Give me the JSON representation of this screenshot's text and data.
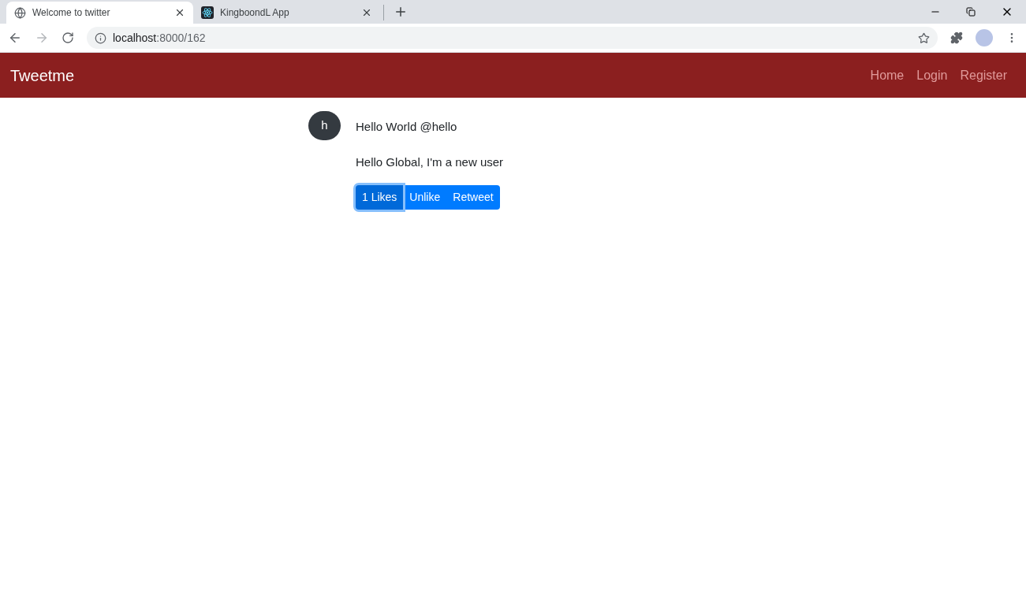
{
  "browser": {
    "tabs": [
      {
        "title": "Welcome to twitter",
        "selected": true,
        "kind": "globe"
      },
      {
        "title": "KingboondL App",
        "selected": false,
        "kind": "react"
      }
    ],
    "address": {
      "host": "localhost",
      "path": ":8000/162"
    },
    "forward_disabled": true
  },
  "navbar": {
    "brand": "Tweetme",
    "links": [
      "Home",
      "Login",
      "Register"
    ]
  },
  "tweet": {
    "avatar": "h",
    "header": "Hello World @hello",
    "content": "Hello Global, I'm a new user",
    "actions": [
      {
        "label": "1 Likes",
        "focused": true
      },
      {
        "label": "Unlike",
        "focused": false
      },
      {
        "label": "Retweet",
        "focused": false
      }
    ]
  }
}
